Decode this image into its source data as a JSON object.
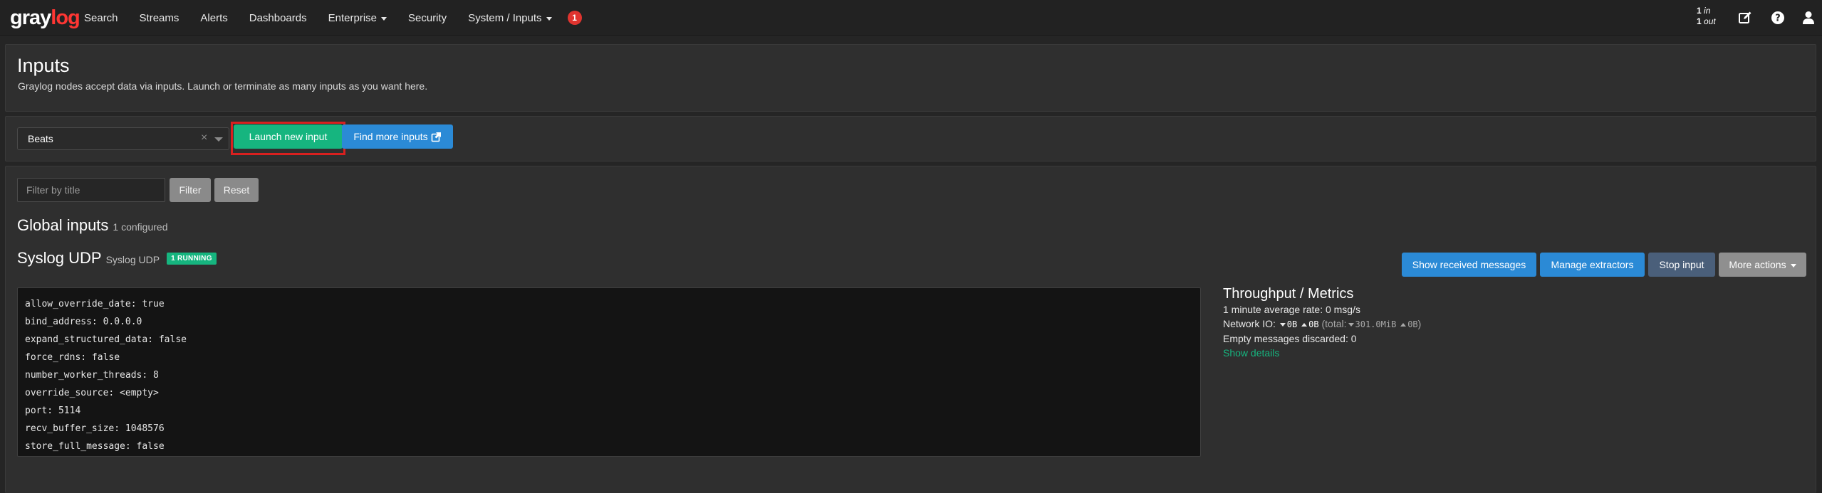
{
  "navbar": {
    "logo": {
      "part1": "gray",
      "part2": "log"
    },
    "links": [
      {
        "label": "Search",
        "caret": false
      },
      {
        "label": "Streams",
        "caret": false
      },
      {
        "label": "Alerts",
        "caret": false
      },
      {
        "label": "Dashboards",
        "caret": false
      },
      {
        "label": "Enterprise",
        "caret": true
      },
      {
        "label": "Security",
        "caret": false
      },
      {
        "label": "System / Inputs",
        "caret": true
      }
    ],
    "notification_count": "1",
    "throughput": {
      "in_count": "1",
      "in_label": "in",
      "out_count": "1",
      "out_label": "out"
    },
    "icons": [
      "edit-icon",
      "help-icon",
      "user-icon"
    ]
  },
  "header": {
    "title": "Inputs",
    "subtitle": "Graylog nodes accept data via inputs. Launch or terminate as many inputs as you want here."
  },
  "launch": {
    "selected_input": "Beats",
    "clear_symbol": "×",
    "launch_button": "Launch new input",
    "find_more_button": "Find more inputs"
  },
  "filter": {
    "placeholder": "Filter by title",
    "filter_button": "Filter",
    "reset_button": "Reset"
  },
  "global_inputs": {
    "title": "Global inputs",
    "count": "1 configured"
  },
  "input": {
    "title": "Syslog UDP",
    "type": "Syslog UDP",
    "status_badge": "1 RUNNING",
    "actions": {
      "show_messages": "Show received messages",
      "manage_extractors": "Manage extractors",
      "stop_input": "Stop input",
      "more_actions": "More actions"
    },
    "config": [
      "allow_override_date: true",
      "bind_address: 0.0.0.0",
      "expand_structured_data: false",
      "force_rdns: false",
      "number_worker_threads: 8",
      "override_source: <empty>",
      "port: 5114",
      "recv_buffer_size: 1048576",
      "store_full_message: false"
    ]
  },
  "metrics": {
    "title": "Throughput / Metrics",
    "avg_rate": "1 minute average rate: 0 msg/s",
    "network_label": "Network IO:",
    "net_down": "0B",
    "net_up": "0B",
    "total_label": "(total:",
    "total_down": "301.0MiB",
    "total_up": "0B",
    "total_close": ")",
    "empty_discarded": "Empty messages discarded: 0",
    "show_details": "Show details"
  },
  "colors": {
    "background": "#252525",
    "navbar": "#222222",
    "panel": "#2f2f2f",
    "accent_green": "#16b57f",
    "accent_blue": "#2b8ad6",
    "brand_red": "#ff3633",
    "highlight_red": "#d9201f"
  }
}
